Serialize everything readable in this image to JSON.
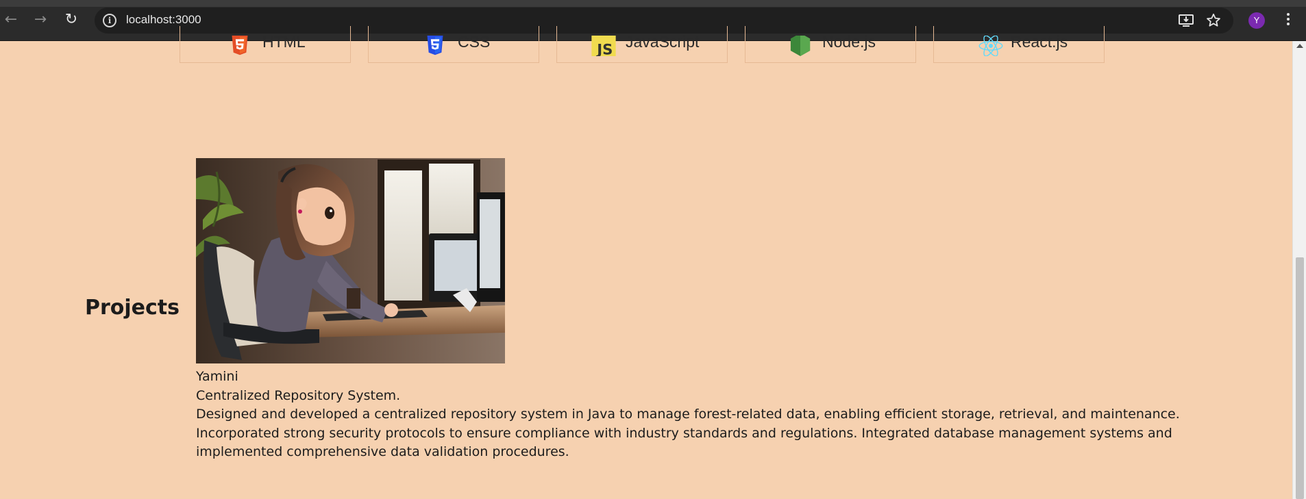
{
  "browser": {
    "url": "localhost:3000",
    "profile_initial": "Y",
    "icons": [
      "back-icon",
      "forward-icon",
      "reload-icon",
      "site-info-icon",
      "install-app-icon",
      "bookmark-star-icon",
      "menu-icon"
    ]
  },
  "skills": [
    {
      "label": "HTML",
      "icon": "html5-icon",
      "color": "#e44d26"
    },
    {
      "label": "CSS",
      "icon": "css3-icon",
      "color": "#264de4"
    },
    {
      "label": "JavaScript",
      "icon": "javascript-icon",
      "color": "#f0db4f"
    },
    {
      "label": "Node.js",
      "icon": "nodejs-icon",
      "color": "#3c873a"
    },
    {
      "label": "React.js",
      "icon": "react-icon",
      "color": "#61dafb"
    }
  ],
  "projects": {
    "heading": "Projects",
    "items": [
      {
        "image_alt": "Animated girl working at a computer desk",
        "author": "Yamini",
        "title": "Centralized Repository System.",
        "description": "Designed and developed a centralized repository system in Java to manage forest-related data, enabling efficient storage, retrieval, and maintenance. Incorporated strong security protocols to ensure compliance with industry standards and regulations. Integrated database management systems and implemented comprehensive data validation procedures."
      }
    ]
  },
  "colors": {
    "page_background": "#f6d1b0",
    "avatar": "#7b2ab0"
  }
}
